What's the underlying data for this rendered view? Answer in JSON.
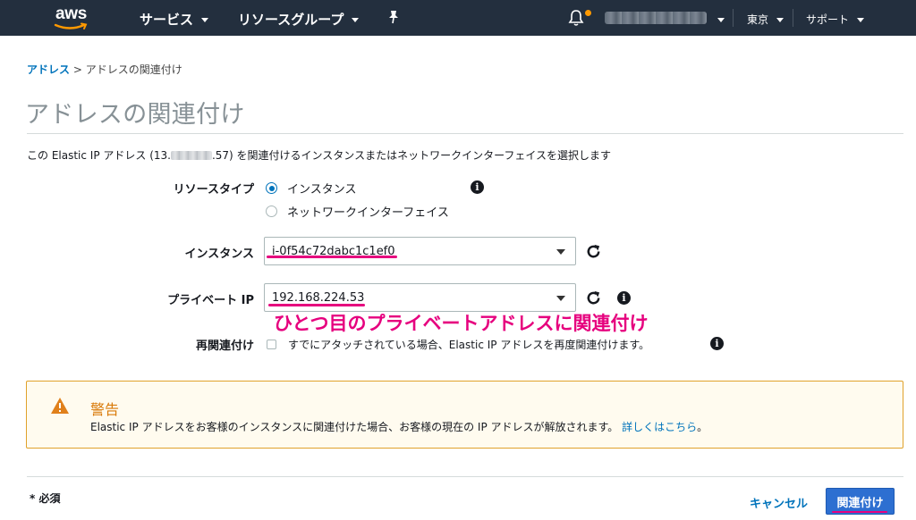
{
  "nav": {
    "logo": "aws",
    "services": "サービス",
    "resource_groups": "リソースグループ",
    "region": "東京",
    "support": "サポート",
    "colors": {
      "bg": "#232f3e",
      "notification_dot": "#ff9900"
    }
  },
  "breadcrumb": {
    "parent": "アドレス",
    "separator": ">",
    "current": "アドレスの関連付け"
  },
  "page_title": "アドレスの関連付け",
  "description": {
    "prefix": "この Elastic IP アドレス (13.",
    "suffix": ".57) を関連付けるインスタンスまたはネットワークインターフェイスを選択します"
  },
  "form": {
    "resource_type": {
      "label": "リソースタイプ",
      "options": [
        "インスタンス",
        "ネットワークインターフェイス"
      ],
      "selected": "インスタンス"
    },
    "instance": {
      "label": "インスタンス",
      "value": "i-0f54c72dabc1c1ef0"
    },
    "private_ip": {
      "label": "プライベート IP",
      "value": "192.168.224.53"
    },
    "reassociate": {
      "label": "再関連付け",
      "checkbox_text": "すでにアタッチされている場合、Elastic IP アドレスを再度関連付けます。",
      "checked": false
    }
  },
  "annotation": "ひとつ目のプライベートアドレスに関連付け",
  "warning": {
    "title": "警告",
    "body": "Elastic IP アドレスをお客様のインスタンスに関連付けた場合、お客様の現在の IP アドレスが解放されます。",
    "link": "詳しくはこちら",
    "end": "。",
    "colors": {
      "border": "#e0a12b",
      "bg": "#fffbef",
      "title": "#d97a08"
    }
  },
  "footer": {
    "required": "* 必須",
    "cancel": "キャンセル",
    "submit": "関連付け"
  },
  "icons": [
    "aws-logo-icon",
    "pin-icon",
    "bell-icon",
    "info-icon",
    "refresh-icon",
    "warning-icon"
  ]
}
